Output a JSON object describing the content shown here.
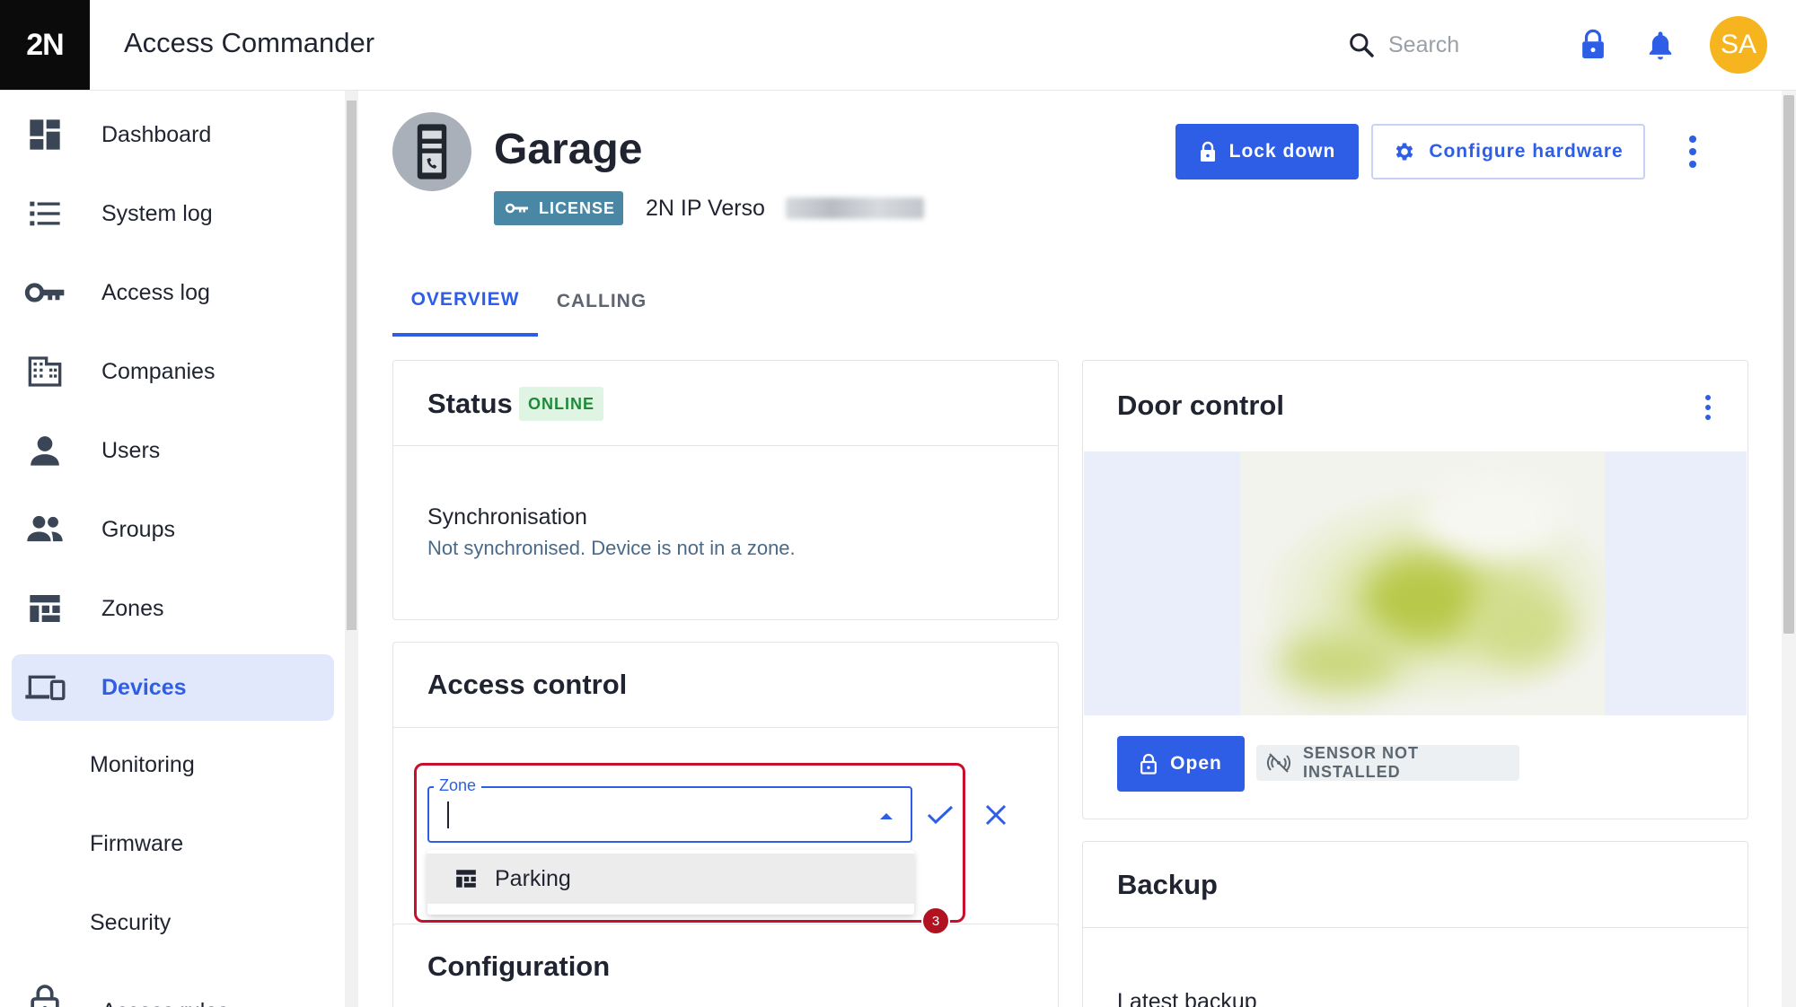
{
  "app": {
    "logo": "2N",
    "title": "Access Commander"
  },
  "header": {
    "search": {
      "placeholder": "Search",
      "icon": "search-icon"
    },
    "avatar_initials": "SA",
    "avatar_color": "#F6B51F"
  },
  "sidebar": {
    "items": [
      {
        "label": "Dashboard",
        "icon": "dashboard-icon"
      },
      {
        "label": "System log",
        "icon": "list-icon"
      },
      {
        "label": "Access log",
        "icon": "key-icon"
      },
      {
        "label": "Companies",
        "icon": "building-icon"
      },
      {
        "label": "Users",
        "icon": "user-icon"
      },
      {
        "label": "Groups",
        "icon": "group-icon"
      },
      {
        "label": "Zones",
        "icon": "zones-icon"
      },
      {
        "label": "Devices",
        "icon": "devices-icon",
        "active": true
      }
    ],
    "sub_items": [
      {
        "label": "Monitoring"
      },
      {
        "label": "Firmware"
      },
      {
        "label": "Security"
      }
    ],
    "bottom_item": {
      "label": "Access rules",
      "icon": "lock-open-icon"
    }
  },
  "device": {
    "name": "Garage",
    "license_label": "LICENSE",
    "model": "2N IP Verso",
    "actions": {
      "lock_down": "Lock down",
      "configure_hardware": "Configure hardware"
    }
  },
  "tabs": [
    {
      "label": "OVERVIEW",
      "active": true
    },
    {
      "label": "CALLING",
      "active": false
    }
  ],
  "status_card": {
    "title": "Status",
    "badge": "ONLINE",
    "sync_title": "Synchronisation",
    "sync_desc": "Not synchronised. Device is not in a zone."
  },
  "access_control_card": {
    "title": "Access control",
    "zone_field": {
      "label": "Zone",
      "value": ""
    },
    "dropdown_options": [
      {
        "label": "Parking",
        "icon": "zones-icon"
      }
    ],
    "step_number": "3"
  },
  "configuration_card": {
    "title": "Configuration"
  },
  "door_control_card": {
    "title": "Door control",
    "open_label": "Open",
    "sensor_label": "SENSOR NOT INSTALLED"
  },
  "backup_card": {
    "title": "Backup",
    "subtitle": "Latest backup"
  },
  "colors": {
    "primary": "#2F5EE6",
    "online_bg": "#DFF4E2",
    "online_text": "#1E8A36",
    "license_bg": "#4A87A4",
    "highlight_border": "#C8102E"
  }
}
